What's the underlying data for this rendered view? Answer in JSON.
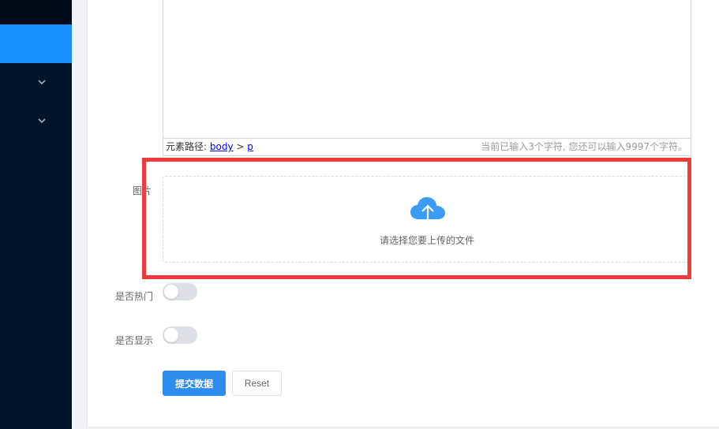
{
  "sidebar": {
    "icons": [
      "chevron-down-icon",
      "chevron-down-icon"
    ],
    "colors": {
      "background": "#001529",
      "active": "#1890ff"
    }
  },
  "editor": {
    "path_label": "元素路径:",
    "path_body": "body",
    "path_sep": ">",
    "path_p": "p",
    "char_count": "当前已输入3个字符, 您还可以输入9997个字符。"
  },
  "form": {
    "image_label": "图片",
    "upload_text": "请选择您要上传的文件",
    "upload_icon": "cloud-upload-icon",
    "hot_label": "是否热门",
    "show_label": "是否显示",
    "hot_switch_on": false,
    "show_switch_on": false,
    "submit_label": "提交数据",
    "reset_label": "Reset"
  },
  "colors": {
    "primary": "#2d8cf0",
    "highlight": "#f0393b",
    "upload_icon": "#3b9cf3"
  }
}
